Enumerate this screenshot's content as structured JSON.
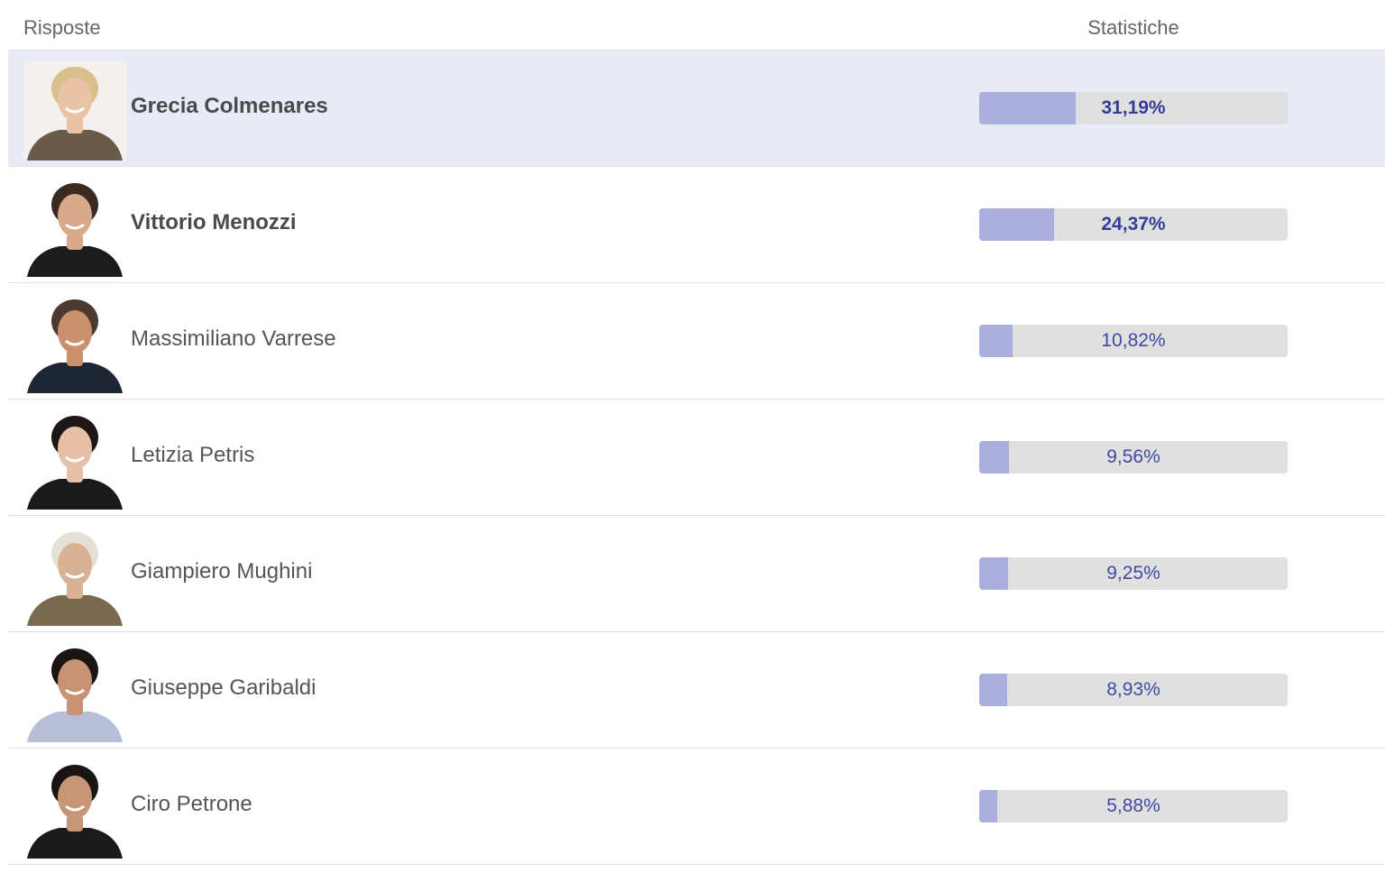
{
  "header": {
    "answers_label": "Risposte",
    "stats_label": "Statistiche"
  },
  "colors": {
    "selected_row": "#e8eaf6",
    "bar_fill": "#a9aedc",
    "bar_track": "#e0e0e0",
    "percent_text": "#3f4aa3"
  },
  "rows": [
    {
      "name": "Grecia Colmenares",
      "percent_label": "31,19%",
      "percent": 31.19,
      "selected": true,
      "top": true,
      "skin": "#e9c3a6",
      "hair": "#d9c08a",
      "shirt": "#6a5a48",
      "bg": "#f3f0ee"
    },
    {
      "name": "Vittorio Menozzi",
      "percent_label": "24,37%",
      "percent": 24.37,
      "selected": false,
      "top": true,
      "skin": "#d8a88a",
      "hair": "#3a2a20",
      "shirt": "#1c1c1c",
      "bg": "#ffffff"
    },
    {
      "name": "Massimiliano Varrese",
      "percent_label": "10,82%",
      "percent": 10.82,
      "selected": false,
      "top": false,
      "skin": "#c9916c",
      "hair": "#4a3a30",
      "shirt": "#1f2633",
      "bg": "#ffffff"
    },
    {
      "name": "Letizia Petris",
      "percent_label": "9,56%",
      "percent": 9.56,
      "selected": false,
      "top": false,
      "skin": "#e6c1a8",
      "hair": "#1e1614",
      "shirt": "#1a1a1a",
      "bg": "#ffffff"
    },
    {
      "name": "Giampiero Mughini",
      "percent_label": "9,25%",
      "percent": 9.25,
      "selected": false,
      "top": false,
      "skin": "#d9b294",
      "hair": "#e4e0d8",
      "shirt": "#7a6a52",
      "bg": "#ffffff"
    },
    {
      "name": "Giuseppe Garibaldi",
      "percent_label": "8,93%",
      "percent": 8.93,
      "selected": false,
      "top": false,
      "skin": "#c89274",
      "hair": "#1a1412",
      "shirt": "#b7bfd8",
      "bg": "#ffffff"
    },
    {
      "name": "Ciro Petrone",
      "percent_label": "5,88%",
      "percent": 5.88,
      "selected": false,
      "top": false,
      "skin": "#c79676",
      "hair": "#1a1412",
      "shirt": "#1a1a1a",
      "bg": "#ffffff"
    }
  ]
}
